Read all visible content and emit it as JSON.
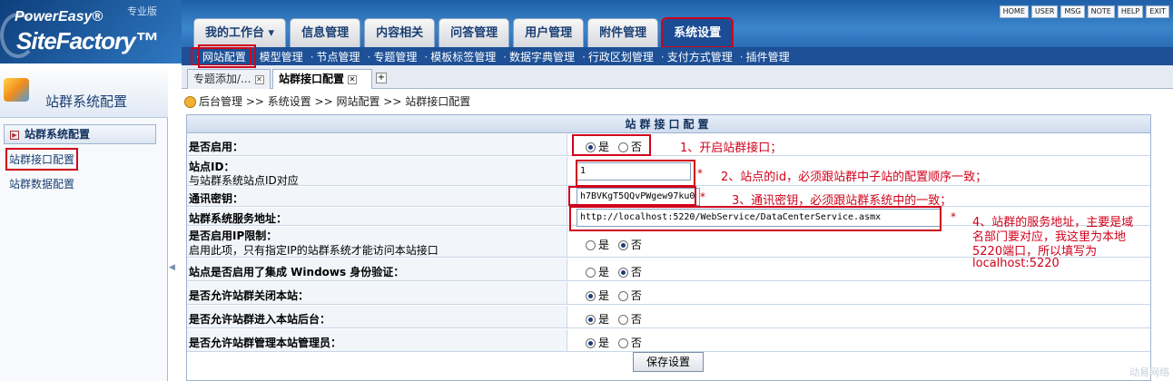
{
  "header": {
    "logo_line1": "PowerEasy®",
    "logo_line2": "SiteFactory™",
    "edition": "专业版",
    "tabs": [
      {
        "label": "我的工作台 ▾"
      },
      {
        "label": "信息管理"
      },
      {
        "label": "内容相关"
      },
      {
        "label": "问答管理"
      },
      {
        "label": "用户管理"
      },
      {
        "label": "附件管理"
      },
      {
        "label": "系统设置"
      }
    ],
    "util_links": [
      "HOME",
      "USER",
      "MSG",
      "NOTE",
      "HELP",
      "EXIT"
    ]
  },
  "subnav": {
    "items": [
      "网站配置",
      "模型管理",
      "节点管理",
      "专题管理",
      "模板标签管理",
      "数据字典管理",
      "行政区划管理",
      "支付方式管理",
      "插件管理"
    ]
  },
  "doc_tabs": [
    {
      "label": "专题添加/..."
    },
    {
      "label": "站群接口配置"
    }
  ],
  "sidebar": {
    "title": "站群系统配置",
    "group": "站群系统配置",
    "items": [
      "站群接口配置",
      "站群数据配置"
    ]
  },
  "breadcrumb": "后台管理 >> 系统设置 >> 网站配置 >> 站群接口配置",
  "form": {
    "title": "站群接口配置",
    "yes": "是",
    "no": "否",
    "rows": {
      "enable": "是否启用：",
      "site_id": "站点ID：",
      "site_id_sub": "与站群系统站点ID对应",
      "site_id_value": "1",
      "key": "通讯密钥：",
      "key_value": "h7BVKgT5QQvPWgew97ku0",
      "service_url": "站群系统服务地址：",
      "service_url_value": "http://localhost:5220/WebService/DataCenterService.asmx",
      "ip_limit": "是否启用IP限制：",
      "ip_limit_sub": "启用此项，只有指定IP的站群系统才能访问本站接口",
      "windows_auth": "站点是否启用了集成 Windows 身份验证：",
      "allow_close": "是否允许站群关闭本站：",
      "allow_backend": "是否允许站群进入本站后台：",
      "allow_admin": "是否允许站群管理本站管理员："
    },
    "save": "保存设置"
  },
  "annotations": {
    "n1": "1、开启站群接口；",
    "n2": "2、站点的id，必须跟站群中子站的配置顺序一致；",
    "n3": "3、通讯密钥，必须跟站群系统中的一致；",
    "n4_l1": "4、站群的服务地址，主要是域",
    "n4_l2": "名部门要对应，我这里为本地",
    "n4_l3": "5220端口，所以填写为",
    "n4_l4": "localhost:5220"
  },
  "watermark": "动易网络"
}
